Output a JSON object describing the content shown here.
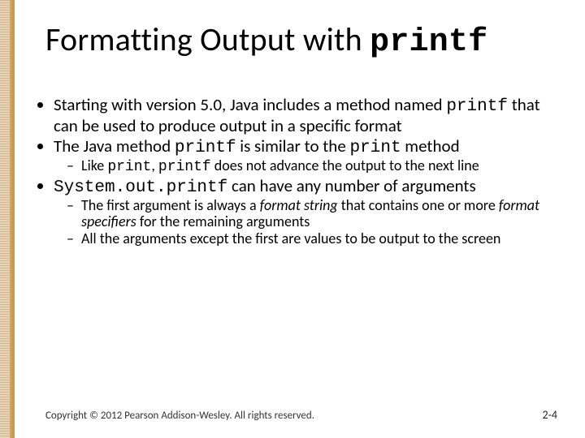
{
  "title": {
    "prefix": "Formatting Output with ",
    "code": "printf"
  },
  "bullets": {
    "b1": {
      "t1": "Starting with version 5.0, Java includes a method named ",
      "c1": "printf",
      "t2": " that can be used to produce output in a specific format"
    },
    "b2": {
      "t1": "The Java method ",
      "c1": "printf",
      "t2": " is similar to the ",
      "c2": "print",
      "t3": " method"
    },
    "b2s1": {
      "t1": "Like ",
      "c1": "print",
      "t2": ", ",
      "c2": "printf",
      "t3": " does not advance the output to the next line"
    },
    "b3": {
      "c1": "System.out.printf",
      "t1": " can have any number of arguments"
    },
    "b3s1": {
      "t1": "The first argument is always a ",
      "i1": "format string",
      "t2": " that contains one or more ",
      "i2": "format specifiers",
      "t3": " for the remaining arguments"
    },
    "b3s2": {
      "t1": "All the arguments except the first are values to be output to the screen"
    }
  },
  "footer": {
    "copyright": "Copyright © 2012 Pearson Addison-Wesley. All rights reserved.",
    "page": "2-4"
  }
}
